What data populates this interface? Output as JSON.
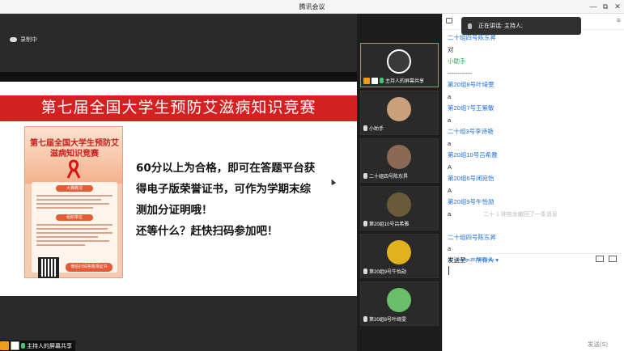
{
  "window": {
    "title": "腾讯会议",
    "minimize": "—",
    "restore": "⧉",
    "close": "✕"
  },
  "stage": {
    "recording_label": "录制中",
    "slide": {
      "banner": "第七届全国大学生预防艾滋病知识竞赛",
      "poster_title": "第七届全国大学生预防艾滋病知识竞赛",
      "poster_pill1": "大赛概况",
      "poster_pill2": "组织单位",
      "poster_button": "微信扫码答题领证书",
      "lines": [
        "60分以上为合格，即可在答题平台获",
        "得电子版荣誉证书，可作为学期末综",
        "测加分证明哦！",
        "还等什么？赶快扫码参加吧！"
      ]
    },
    "share_label": "主持人的屏幕共享"
  },
  "gallery": [
    {
      "label": "主持人的屏幕共享",
      "active": true,
      "avatar_color": "#3a3a3a"
    },
    {
      "label": "小助手",
      "active": false,
      "avatar_color": "#c9a07a"
    },
    {
      "label": "二十组四号陈东昇",
      "active": false,
      "avatar_color": "#8a6a55"
    },
    {
      "label": "第20组10号吕希雅",
      "active": false,
      "avatar_color": "#6b5a3a"
    },
    {
      "label": "第20组9号牛怡勋",
      "active": false,
      "avatar_color": "#e0b21e"
    },
    {
      "label": "第20组8号叶绮雯",
      "active": false,
      "avatar_color": "#6abf6a"
    }
  ],
  "chat": {
    "speaker_label": "正在讲话: 主持人;",
    "messages": [
      {
        "kind": "name",
        "text": "二十组四号陈东昇"
      },
      {
        "kind": "txt",
        "text": "对"
      },
      {
        "kind": "green",
        "text": "小助手"
      },
      {
        "kind": "txt",
        "text": "------------"
      },
      {
        "kind": "name",
        "text": "第20组8号叶绮雯"
      },
      {
        "kind": "txt",
        "text": "a"
      },
      {
        "kind": "name",
        "text": "第20组7号王紫敏"
      },
      {
        "kind": "txt",
        "text": "a"
      },
      {
        "kind": "name",
        "text": "二十组3号李诗艳"
      },
      {
        "kind": "txt",
        "text": "a"
      },
      {
        "kind": "name",
        "text": "第20组10号吕希雅"
      },
      {
        "kind": "txt",
        "text": "A"
      },
      {
        "kind": "name",
        "text": "第20组6号闭宛怡"
      },
      {
        "kind": "txt",
        "text": "A"
      },
      {
        "kind": "name",
        "text": "第20组9号牛怡勋"
      },
      {
        "kind": "txt",
        "text": "a"
      },
      {
        "kind": "spacer",
        "text": ""
      },
      {
        "kind": "name",
        "text": "二十组四号陈东昇"
      },
      {
        "kind": "txt",
        "text": "a"
      },
      {
        "kind": "name",
        "text": "第20组6号闭宛怡"
      }
    ],
    "recall_notice": "二十 1 钟宛龙撤回了一条消息",
    "send_to_label": "发送至:",
    "send_to_value": "所有人 ▾",
    "send_button": "发送(S)"
  },
  "colors": {
    "accent_blue": "#1e6fd9",
    "banner_red": "#d32020",
    "active_green": "#4bc271"
  }
}
